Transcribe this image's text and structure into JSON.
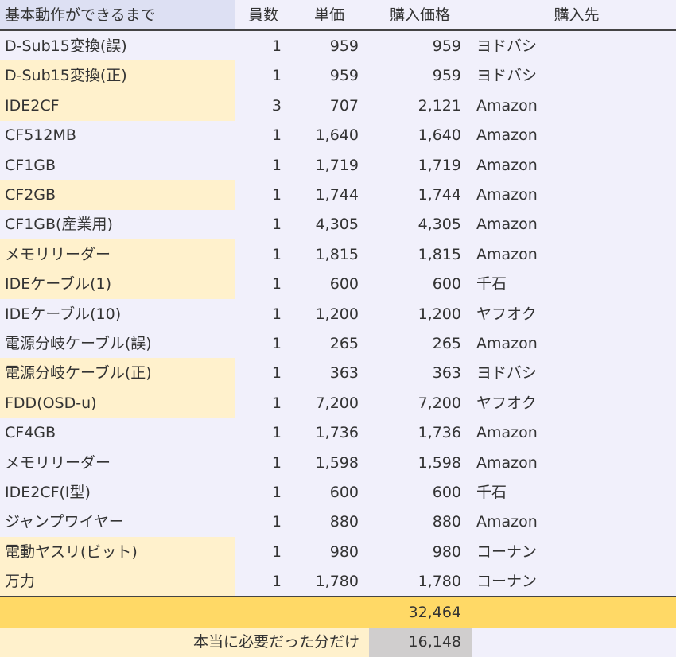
{
  "headers": {
    "name": "基本動作ができるまで",
    "qty": "員数",
    "unit_price": "単価",
    "purchase_price": "購入価格",
    "shop": "購入先"
  },
  "rows": [
    {
      "name": "D-Sub15変換(誤)",
      "qty": "1",
      "unit_price": "959",
      "purchase_price": "959",
      "shop": "ヨドバシ",
      "highlight": false
    },
    {
      "name": "D-Sub15変換(正)",
      "qty": "1",
      "unit_price": "959",
      "purchase_price": "959",
      "shop": "ヨドバシ",
      "highlight": true
    },
    {
      "name": "IDE2CF",
      "qty": "3",
      "unit_price": "707",
      "purchase_price": "2,121",
      "shop": "Amazon",
      "highlight": true
    },
    {
      "name": "CF512MB",
      "qty": "1",
      "unit_price": "1,640",
      "purchase_price": "1,640",
      "shop": "Amazon",
      "highlight": false
    },
    {
      "name": "CF1GB",
      "qty": "1",
      "unit_price": "1,719",
      "purchase_price": "1,719",
      "shop": "Amazon",
      "highlight": false
    },
    {
      "name": "CF2GB",
      "qty": "1",
      "unit_price": "1,744",
      "purchase_price": "1,744",
      "shop": "Amazon",
      "highlight": true
    },
    {
      "name": "CF1GB(産業用)",
      "qty": "1",
      "unit_price": "4,305",
      "purchase_price": "4,305",
      "shop": "Amazon",
      "highlight": false
    },
    {
      "name": "メモリリーダー",
      "qty": "1",
      "unit_price": "1,815",
      "purchase_price": "1,815",
      "shop": "Amazon",
      "highlight": true
    },
    {
      "name": "IDEケーブル(1)",
      "qty": "1",
      "unit_price": "600",
      "purchase_price": "600",
      "shop": "千石",
      "highlight": true
    },
    {
      "name": "IDEケーブル(10)",
      "qty": "1",
      "unit_price": "1,200",
      "purchase_price": "1,200",
      "shop": "ヤフオク",
      "highlight": false
    },
    {
      "name": "電源分岐ケーブル(誤)",
      "qty": "1",
      "unit_price": "265",
      "purchase_price": "265",
      "shop": "Amazon",
      "highlight": false
    },
    {
      "name": "電源分岐ケーブル(正)",
      "qty": "1",
      "unit_price": "363",
      "purchase_price": "363",
      "shop": "ヨドバシ",
      "highlight": true
    },
    {
      "name": "FDD(OSD-u)",
      "qty": "1",
      "unit_price": "7,200",
      "purchase_price": "7,200",
      "shop": "ヤフオク",
      "highlight": true
    },
    {
      "name": "CF4GB",
      "qty": "1",
      "unit_price": "1,736",
      "purchase_price": "1,736",
      "shop": "Amazon",
      "highlight": false
    },
    {
      "name": "メモリリーダー",
      "qty": "1",
      "unit_price": "1,598",
      "purchase_price": "1,598",
      "shop": "Amazon",
      "highlight": false
    },
    {
      "name": "IDE2CF(I型)",
      "qty": "1",
      "unit_price": "600",
      "purchase_price": "600",
      "shop": "千石",
      "highlight": false
    },
    {
      "name": "ジャンプワイヤー",
      "qty": "1",
      "unit_price": "880",
      "purchase_price": "880",
      "shop": "Amazon",
      "highlight": false
    },
    {
      "name": "電動ヤスリ(ビット)",
      "qty": "1",
      "unit_price": "980",
      "purchase_price": "980",
      "shop": "コーナン",
      "highlight": true
    },
    {
      "name": "万力",
      "qty": "1",
      "unit_price": "1,780",
      "purchase_price": "1,780",
      "shop": "コーナン",
      "highlight": true
    }
  ],
  "total": "32,464",
  "needed": {
    "label": "本当に必要だった分だけ",
    "value": "16,148"
  },
  "colors": {
    "background": "#f1f0fb",
    "header_name_fill": "#dde0f3",
    "row_highlight": "#fff1cc",
    "total_band": "#ffd966",
    "needed_value_fill": "#d0cece"
  }
}
